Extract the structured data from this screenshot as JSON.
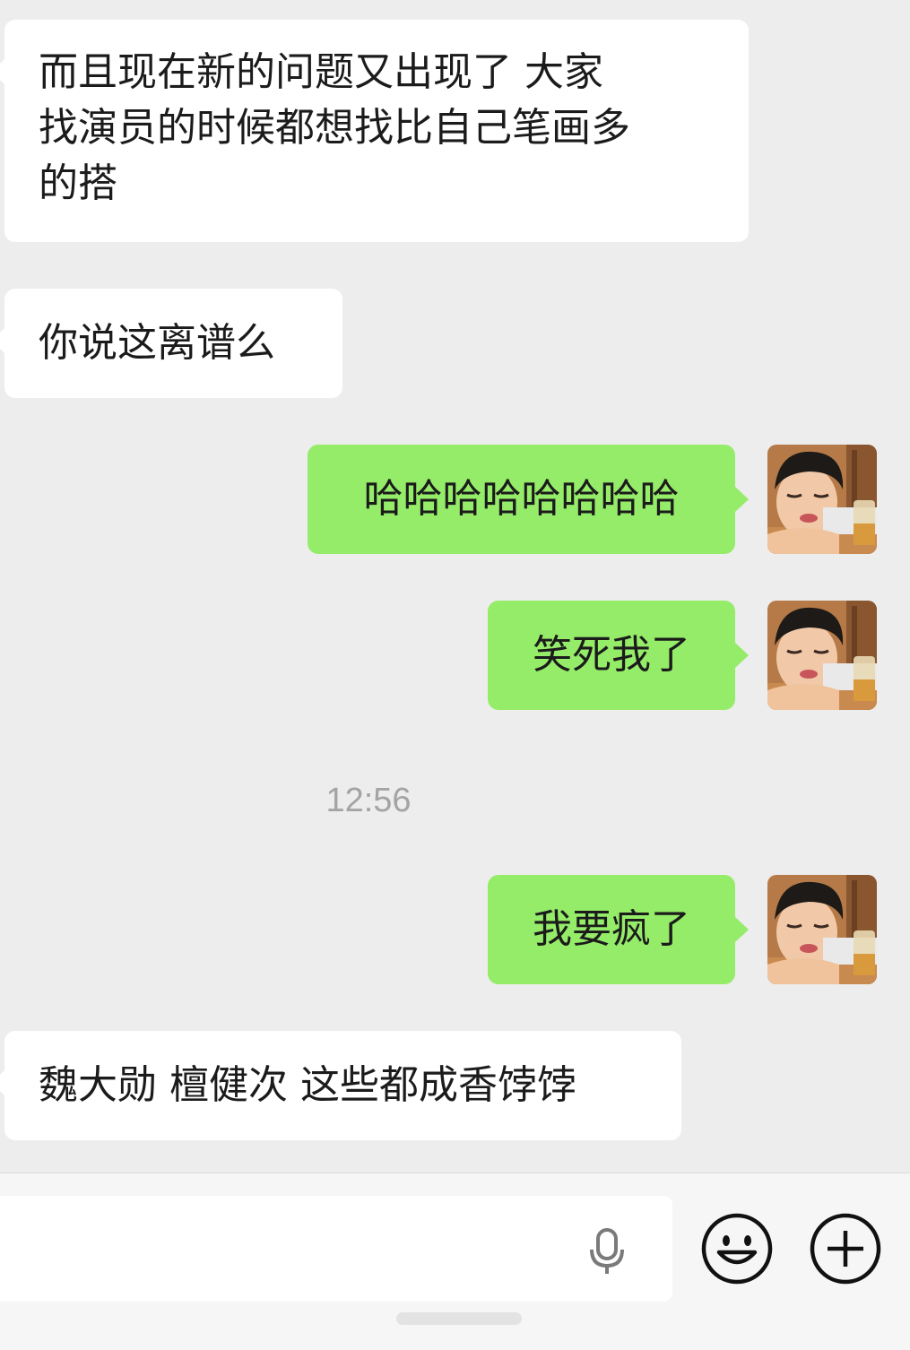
{
  "messages": [
    {
      "side": "incoming",
      "text": "而且现在新的问题又出现了 大家\n找演员的时候都想找比自己笔画多\n的搭"
    },
    {
      "side": "incoming",
      "text": "你说这离谱么"
    },
    {
      "side": "outgoing",
      "text": "哈哈哈哈哈哈哈哈"
    },
    {
      "side": "outgoing",
      "text": "笑死我了"
    },
    {
      "side": "outgoing",
      "text": "我要疯了"
    },
    {
      "side": "incoming",
      "text": "魏大勋 檀健次 这些都成香饽饽"
    }
  ],
  "timestamp": "12:56",
  "composer": {
    "voice_icon": "microphone-icon",
    "emoji_icon": "smiley-icon",
    "plus_icon": "plus-icon"
  },
  "colors": {
    "background": "#ededed",
    "incoming_bubble": "#ffffff",
    "outgoing_bubble": "#95ec69",
    "timestamp_text": "#a4a4a4"
  }
}
